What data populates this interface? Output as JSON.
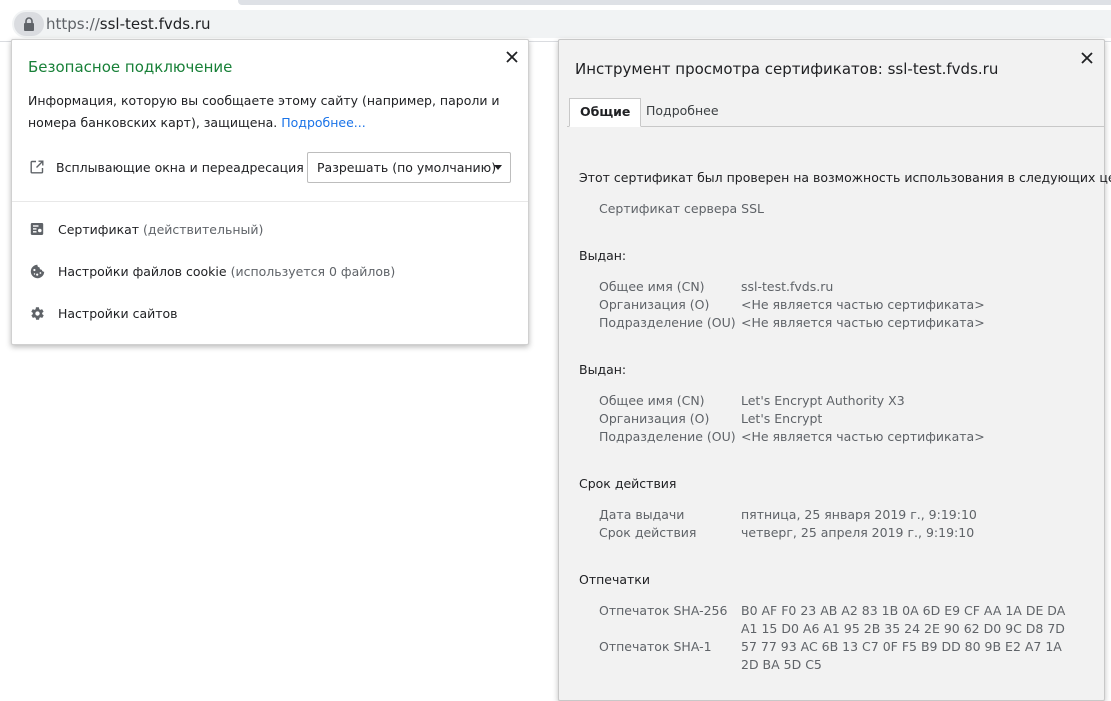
{
  "address_bar": {
    "url_scheme": "https://",
    "url_host": "ssl-test.fvds.ru"
  },
  "page_info": {
    "title": "Безопасное подключение",
    "description": "Информация, которую вы сообщаете этому сайту (например, пароли и номера банковских карт), защищена.",
    "learn_more": "Подробнее...",
    "popups_label": "Всплывающие окна и переадресация",
    "popups_value": "Разрешать (по умолчанию)",
    "certificate_label": "Сертификат",
    "certificate_status": "(действительный)",
    "cookies_label": "Настройки файлов cookie",
    "cookies_status": "(используется 0 файлов)",
    "site_settings_label": "Настройки сайтов"
  },
  "cert_viewer": {
    "title": "Инструмент просмотра сертификатов: ssl-test.fvds.ru",
    "tabs": {
      "general": "Общие",
      "details": "Подробнее"
    },
    "purposes_heading": "Этот сертификат был проверен на возможность использования в следующих целях:",
    "purpose": "Сертификат сервера SSL",
    "issued_to_heading": "Выдан:",
    "issued_to": {
      "cn_label": "Общее имя (CN)",
      "cn": "ssl-test.fvds.ru",
      "o_label": "Организация (O)",
      "o": "<Не является частью сертификата>",
      "ou_label": "Подразделение (OU)",
      "ou": "<Не является частью сертификата>"
    },
    "issued_by_heading": "Выдан:",
    "issued_by": {
      "cn_label": "Общее имя (CN)",
      "cn": "Let's Encrypt Authority X3",
      "o_label": "Организация (O)",
      "o": "Let's Encrypt",
      "ou_label": "Подразделение (OU)",
      "ou": "<Не является частью сертификата>"
    },
    "validity_heading": "Срок действия",
    "validity": {
      "issued_label": "Дата выдачи",
      "issued": "пятница, 25 января 2019 г., 9:19:10",
      "expires_label": "Срок действия",
      "expires": "четверг, 25 апреля 2019 г., 9:19:10"
    },
    "fingerprints_heading": "Отпечатки",
    "fingerprints": {
      "sha256_label": "Отпечаток SHA-256",
      "sha256_line1": "B0 AF F0 23 AB A2 83 1B 0A 6D E9 CF AA 1A DE DA",
      "sha256_line2": "A1 15 D0 A6 A1 95 2B 35 24 2E 90 62 D0 9C D8 7D",
      "sha1_label": "Отпечаток SHA-1",
      "sha1_line1": "57 77 93 AC 6B 13 C7 0F F5 B9 DD 80 9B E2 A7 1A",
      "sha1_line2": "2D BA 5D C5"
    }
  },
  "icons": {
    "lock": "lock-icon",
    "external": "open-in-new-icon",
    "certificate": "certificate-icon",
    "cookie": "cookie-icon",
    "settings": "gear-icon",
    "close": "close-icon",
    "dropdown": "dropdown-arrow-icon"
  }
}
